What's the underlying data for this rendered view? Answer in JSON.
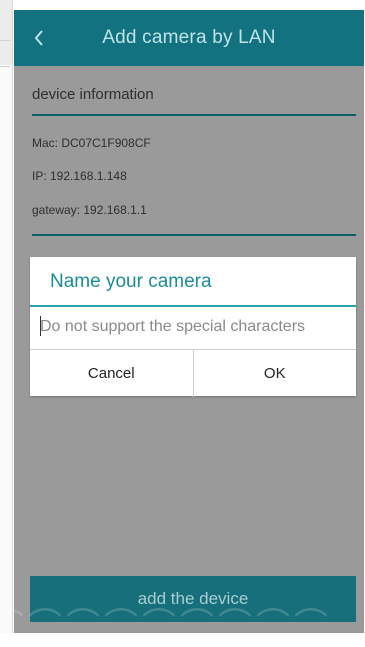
{
  "header": {
    "title": "Add camera by LAN",
    "back_icon": "chevron-left-icon"
  },
  "device_info": {
    "section_title": "device information",
    "mac": "Mac:  DC07C1F908CF",
    "ip": "IP:  192.168.1.148",
    "gateway": "gateway:  192.168.1.1"
  },
  "dialog": {
    "title": "Name your camera",
    "input_value": "",
    "input_placeholder": "Do not support the special characters",
    "cancel_label": "Cancel",
    "ok_label": "OK"
  },
  "footer": {
    "add_device_label": "add the device"
  },
  "colors": {
    "header_bg": "#13727f",
    "accent": "#1b8d98",
    "overlay": "#9a9a9a"
  }
}
